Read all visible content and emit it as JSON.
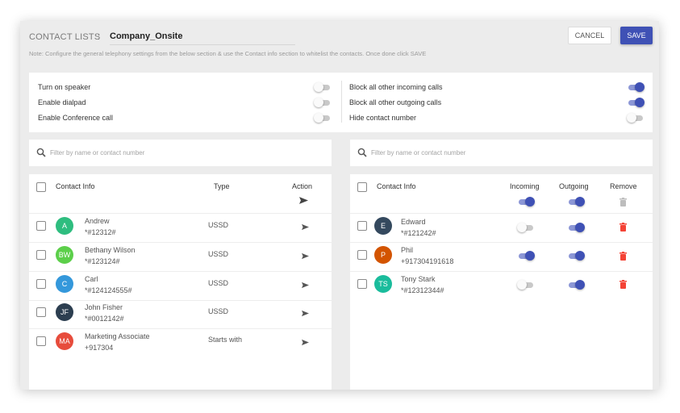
{
  "header": {
    "label": "CONTACT LISTS",
    "separator": ":",
    "list_name": "Company_Onsite",
    "note": "Note: Configure the general telephony settings from the below section & use the Contact info section to whitelist the contacts. Once done click SAVE",
    "cancel_label": "CANCEL",
    "save_label": "SAVE"
  },
  "settings": {
    "left": [
      {
        "label": "Turn on speaker",
        "on": false
      },
      {
        "label": "Enable dialpad",
        "on": false
      },
      {
        "label": "Enable Conference call",
        "on": false
      }
    ],
    "right": [
      {
        "label": "Block all other incoming calls",
        "on": true
      },
      {
        "label": "Block all other outgoing calls",
        "on": true
      },
      {
        "label": "Hide contact number",
        "on": false
      }
    ]
  },
  "search": {
    "placeholder": "Filter by name or contact number"
  },
  "left_panel": {
    "headers": {
      "contact": "Contact Info",
      "type": "Type",
      "action": "Action"
    },
    "rows": [
      {
        "initials": "A",
        "name": "Andrew",
        "number": "*#12312#",
        "type": "USSD",
        "color": "#2ebd7f"
      },
      {
        "initials": "BW",
        "name": "Bethany Wilson",
        "number": "*#123124#",
        "type": "USSD",
        "color": "#5ccf4a"
      },
      {
        "initials": "C",
        "name": "Carl",
        "number": "*#124124555#",
        "type": "USSD",
        "color": "#3498db"
      },
      {
        "initials": "JF",
        "name": "John Fisher",
        "number": "*#0012142#",
        "type": "USSD",
        "color": "#2c3e50"
      },
      {
        "initials": "MA",
        "name": "Marketing Associate",
        "number": "+917304",
        "type": "Starts with",
        "color": "#e74c3c"
      }
    ]
  },
  "right_panel": {
    "headers": {
      "contact": "Contact Info",
      "incoming": "Incoming",
      "outgoing": "Outgoing",
      "remove": "Remove"
    },
    "header_toggles": {
      "incoming": true,
      "outgoing": true
    },
    "rows": [
      {
        "initials": "E",
        "name": "Edward",
        "number": "*#121242#",
        "incoming": false,
        "outgoing": true,
        "color": "#34495e"
      },
      {
        "initials": "P",
        "name": "Phil",
        "number": "+917304191618",
        "incoming": true,
        "outgoing": true,
        "color": "#d35400"
      },
      {
        "initials": "TS",
        "name": "Tony Stark",
        "number": "*#12312344#",
        "incoming": false,
        "outgoing": true,
        "color": "#1abc9c"
      }
    ]
  },
  "colors": {
    "accent": "#3f51b5",
    "danger": "#f44336"
  },
  "icons": {
    "search": "search-icon",
    "send": "send-icon",
    "delete": "delete-icon"
  }
}
